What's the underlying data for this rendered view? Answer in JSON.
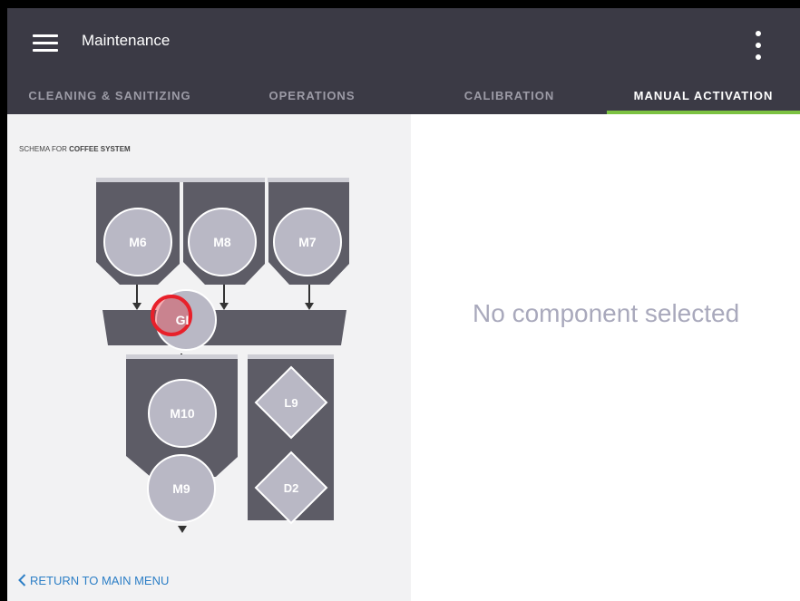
{
  "app_title": "Maintenance",
  "tabs": [
    {
      "label": "CLEANING & SANITIZING",
      "active": false
    },
    {
      "label": "OPERATIONS",
      "active": false
    },
    {
      "label": "CALIBRATION",
      "active": false
    },
    {
      "label": "MANUAL ACTIVATION",
      "active": true
    }
  ],
  "schema": {
    "label_prefix": "SCHEMA FOR ",
    "label_system": "COFFEE SYSTEM",
    "components": {
      "m6": "M6",
      "m8": "M8",
      "m7": "M7",
      "gi": "GI",
      "m10": "M10",
      "m9": "M9",
      "l9": "L9",
      "d2": "D2"
    }
  },
  "detail": {
    "empty_message": "No component selected"
  },
  "footer": {
    "return_label": "RETURN TO MAIN MENU"
  },
  "colors": {
    "appbar": "#3b3a45",
    "tab_indicator": "#7cc242",
    "component_fill": "#5d5c66",
    "circle_fill": "#b9b8c5",
    "highlight": "#e8202a",
    "link": "#2d7fc6"
  },
  "icons": [
    "menu-icon",
    "more-vert-icon",
    "chevron-left-icon"
  ]
}
